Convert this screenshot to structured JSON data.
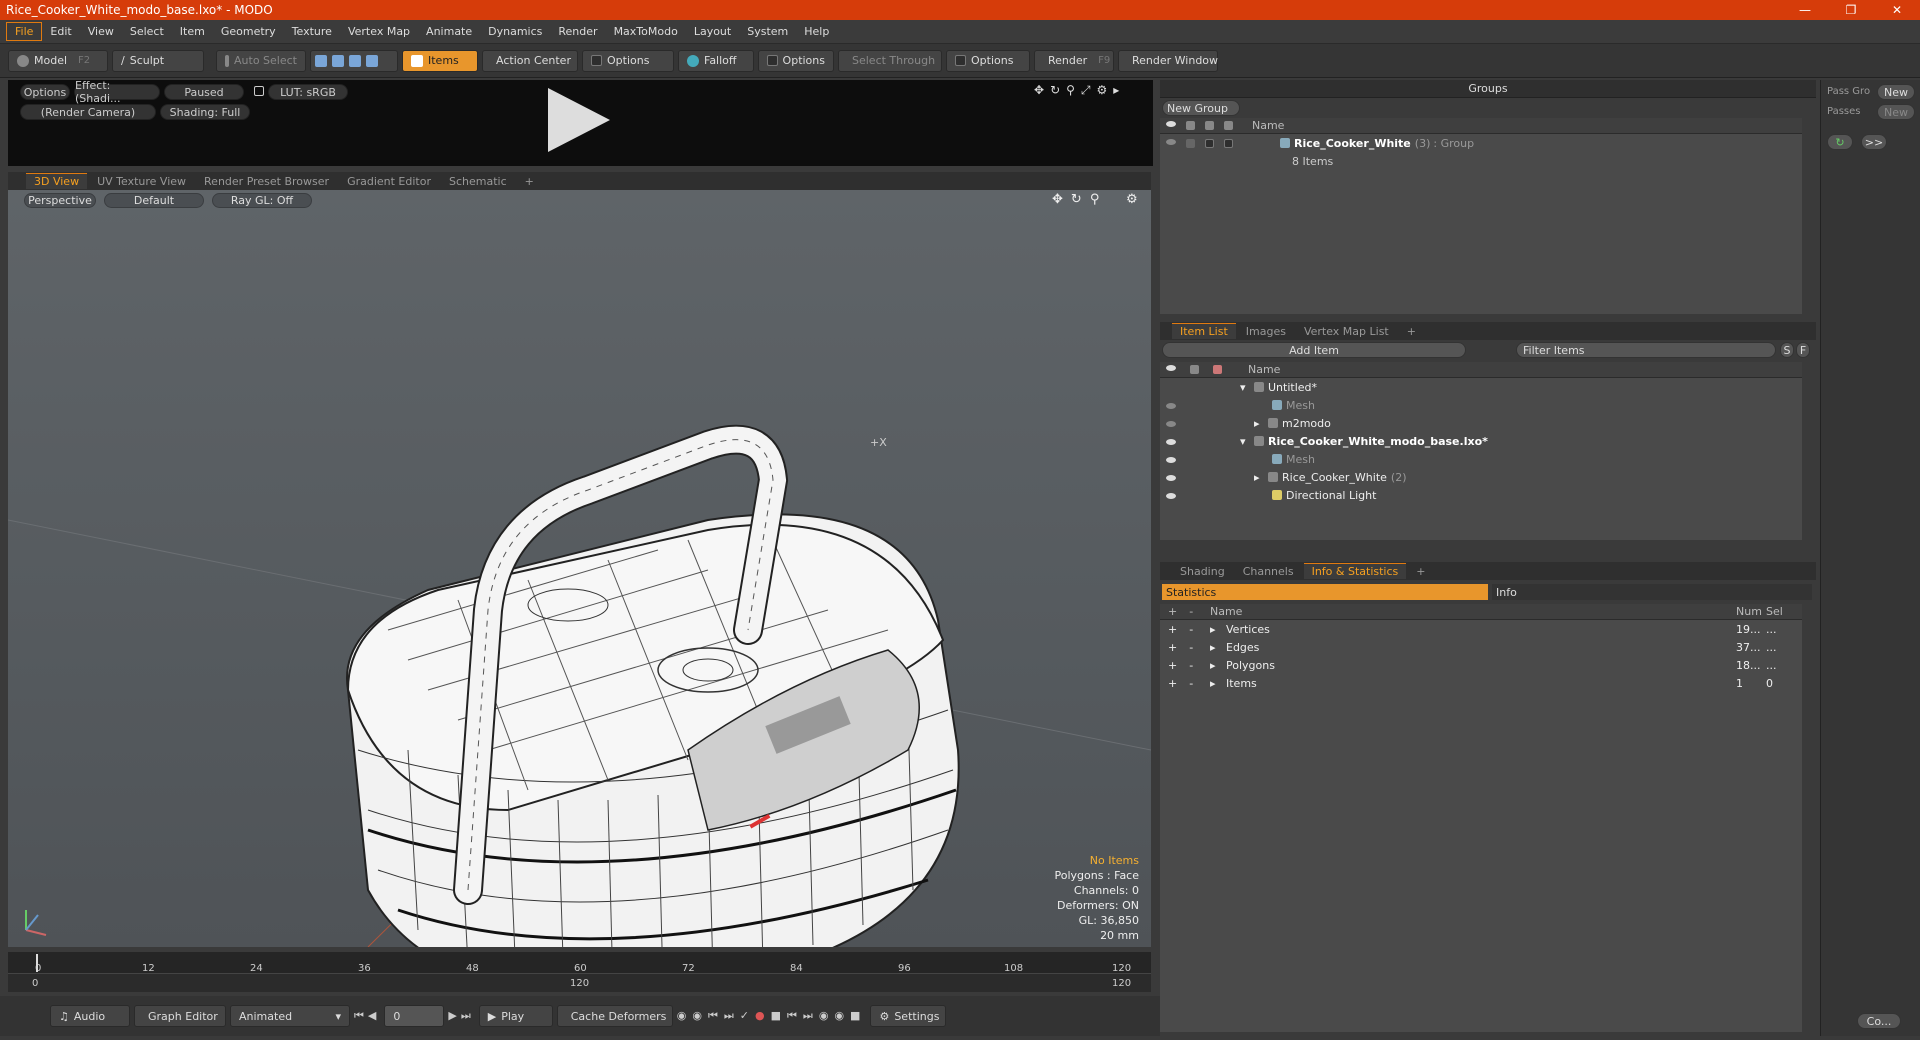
{
  "window": {
    "title": "Rice_Cooker_White_modo_base.lxo* - MODO"
  },
  "menu": [
    "File",
    "Edit",
    "View",
    "Select",
    "Item",
    "Geometry",
    "Texture",
    "Vertex Map",
    "Animate",
    "Dynamics",
    "Render",
    "MaxToModo",
    "Layout",
    "System",
    "Help"
  ],
  "toolbar": {
    "model": "Model",
    "model_key": "F2",
    "sculpt": "Sculpt",
    "auto_select": "Auto Select",
    "items": "Items",
    "action_center": "Action Center",
    "options1": "Options",
    "falloff": "Falloff",
    "options2": "Options",
    "select_through": "Select Through",
    "options3": "Options",
    "render": "Render",
    "render_key": "F9",
    "render_window": "Render Window"
  },
  "preview": {
    "options": "Options",
    "effect": "Effect: (Shadi...",
    "paused": "Paused",
    "lut": "LUT: sRGB",
    "camera": "(Render Camera)",
    "shading": "Shading: Full"
  },
  "viewtabs": [
    "3D View",
    "UV Texture View",
    "Render Preset Browser",
    "Gradient Editor",
    "Schematic",
    "+"
  ],
  "viewport": {
    "perspective": "Perspective",
    "default": "Default",
    "raygl": "Ray GL: Off",
    "overlay": {
      "no_items": "No Items",
      "polygons": "Polygons : Face",
      "channels": "Channels: 0",
      "deformers": "Deformers: ON",
      "gl": "GL: 36,850",
      "scale": "20 mm"
    },
    "marker": "+X"
  },
  "timeline": {
    "ticks": [
      "0",
      "12",
      "24",
      "36",
      "48",
      "60",
      "72",
      "84",
      "96",
      "108",
      "120"
    ],
    "range_start": "0",
    "range_mid": "120",
    "range_end": "120"
  },
  "bottombar": {
    "audio": "Audio",
    "graph_editor": "Graph Editor",
    "animated": "Animated",
    "frame": "0",
    "play": "Play",
    "cache": "Cache Deformers",
    "settings": "Settings"
  },
  "groups": {
    "header": "Groups",
    "new_group": "New Group",
    "col_name": "Name",
    "item_name": "Rice_Cooker_White",
    "item_count": "(3)",
    "item_type": ": Group",
    "item_sub": "8 Items"
  },
  "far_right": {
    "pass_gro": "Pass Gro",
    "new1": "New",
    "passes": "Passes",
    "new2": "New",
    "arrow": ">>",
    "co": "Co..."
  },
  "itemlist": {
    "tabs": [
      "Item List",
      "Images",
      "Vertex Map List",
      "+"
    ],
    "add_item": "Add Item",
    "filter": "Filter Items",
    "s": "S",
    "f": "F",
    "col_name": "Name",
    "rows": [
      {
        "label": "Untitled*",
        "indent": 0
      },
      {
        "label": "Mesh",
        "indent": 1
      },
      {
        "label": "m2modo",
        "indent": 1
      },
      {
        "label": "Rice_Cooker_White_modo_base.lxo*",
        "indent": 0
      },
      {
        "label": "Mesh",
        "indent": 1
      },
      {
        "label": "Rice_Cooker_White",
        "count": "(2)",
        "indent": 1
      },
      {
        "label": "Directional Light",
        "indent": 1
      }
    ]
  },
  "info": {
    "tabs": [
      "Shading",
      "Channels",
      "Info & Statistics",
      "+"
    ],
    "statistics": "Statistics",
    "info": "Info",
    "cols": {
      "name": "Name",
      "num": "Num",
      "sel": "Sel"
    },
    "rows": [
      {
        "name": "Vertices",
        "num": "19...",
        "sel": "..."
      },
      {
        "name": "Edges",
        "num": "37...",
        "sel": "..."
      },
      {
        "name": "Polygons",
        "num": "18...",
        "sel": "..."
      },
      {
        "name": "Items",
        "num": "1",
        "sel": "0"
      }
    ]
  },
  "colors": {
    "accent": "#e8962c",
    "titlebar": "#d63c0a"
  }
}
